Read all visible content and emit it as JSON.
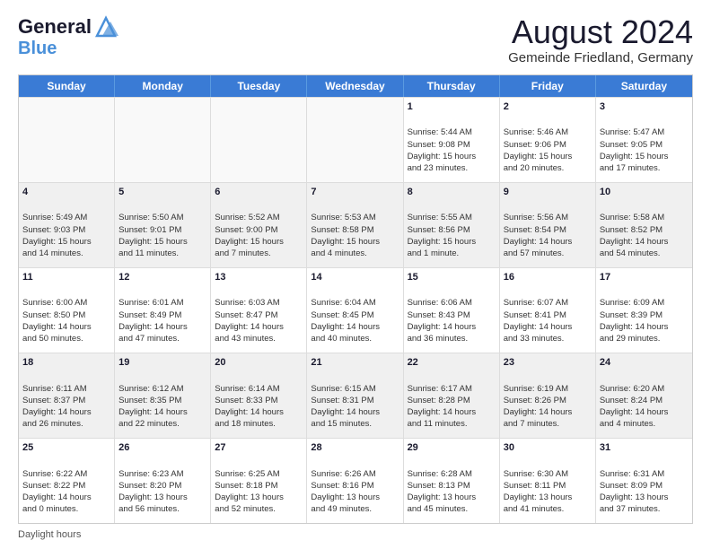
{
  "logo": {
    "line1": "General",
    "line2": "Blue"
  },
  "title": "August 2024",
  "subtitle": "Gemeinde Friedland, Germany",
  "days_of_week": [
    "Sunday",
    "Monday",
    "Tuesday",
    "Wednesday",
    "Thursday",
    "Friday",
    "Saturday"
  ],
  "footer_text": "Daylight hours",
  "weeks": [
    {
      "cells": [
        {
          "day": "",
          "empty": true
        },
        {
          "day": "",
          "empty": true
        },
        {
          "day": "",
          "empty": true
        },
        {
          "day": "",
          "empty": true
        },
        {
          "day": "1",
          "lines": [
            "Sunrise: 5:44 AM",
            "Sunset: 9:08 PM",
            "Daylight: 15 hours",
            "and 23 minutes."
          ]
        },
        {
          "day": "2",
          "lines": [
            "Sunrise: 5:46 AM",
            "Sunset: 9:06 PM",
            "Daylight: 15 hours",
            "and 20 minutes."
          ]
        },
        {
          "day": "3",
          "lines": [
            "Sunrise: 5:47 AM",
            "Sunset: 9:05 PM",
            "Daylight: 15 hours",
            "and 17 minutes."
          ]
        }
      ]
    },
    {
      "cells": [
        {
          "day": "4",
          "lines": [
            "Sunrise: 5:49 AM",
            "Sunset: 9:03 PM",
            "Daylight: 15 hours",
            "and 14 minutes."
          ]
        },
        {
          "day": "5",
          "lines": [
            "Sunrise: 5:50 AM",
            "Sunset: 9:01 PM",
            "Daylight: 15 hours",
            "and 11 minutes."
          ]
        },
        {
          "day": "6",
          "lines": [
            "Sunrise: 5:52 AM",
            "Sunset: 9:00 PM",
            "Daylight: 15 hours",
            "and 7 minutes."
          ]
        },
        {
          "day": "7",
          "lines": [
            "Sunrise: 5:53 AM",
            "Sunset: 8:58 PM",
            "Daylight: 15 hours",
            "and 4 minutes."
          ]
        },
        {
          "day": "8",
          "lines": [
            "Sunrise: 5:55 AM",
            "Sunset: 8:56 PM",
            "Daylight: 15 hours",
            "and 1 minute."
          ]
        },
        {
          "day": "9",
          "lines": [
            "Sunrise: 5:56 AM",
            "Sunset: 8:54 PM",
            "Daylight: 14 hours",
            "and 57 minutes."
          ]
        },
        {
          "day": "10",
          "lines": [
            "Sunrise: 5:58 AM",
            "Sunset: 8:52 PM",
            "Daylight: 14 hours",
            "and 54 minutes."
          ]
        }
      ]
    },
    {
      "cells": [
        {
          "day": "11",
          "lines": [
            "Sunrise: 6:00 AM",
            "Sunset: 8:50 PM",
            "Daylight: 14 hours",
            "and 50 minutes."
          ]
        },
        {
          "day": "12",
          "lines": [
            "Sunrise: 6:01 AM",
            "Sunset: 8:49 PM",
            "Daylight: 14 hours",
            "and 47 minutes."
          ]
        },
        {
          "day": "13",
          "lines": [
            "Sunrise: 6:03 AM",
            "Sunset: 8:47 PM",
            "Daylight: 14 hours",
            "and 43 minutes."
          ]
        },
        {
          "day": "14",
          "lines": [
            "Sunrise: 6:04 AM",
            "Sunset: 8:45 PM",
            "Daylight: 14 hours",
            "and 40 minutes."
          ]
        },
        {
          "day": "15",
          "lines": [
            "Sunrise: 6:06 AM",
            "Sunset: 8:43 PM",
            "Daylight: 14 hours",
            "and 36 minutes."
          ]
        },
        {
          "day": "16",
          "lines": [
            "Sunrise: 6:07 AM",
            "Sunset: 8:41 PM",
            "Daylight: 14 hours",
            "and 33 minutes."
          ]
        },
        {
          "day": "17",
          "lines": [
            "Sunrise: 6:09 AM",
            "Sunset: 8:39 PM",
            "Daylight: 14 hours",
            "and 29 minutes."
          ]
        }
      ]
    },
    {
      "cells": [
        {
          "day": "18",
          "lines": [
            "Sunrise: 6:11 AM",
            "Sunset: 8:37 PM",
            "Daylight: 14 hours",
            "and 26 minutes."
          ]
        },
        {
          "day": "19",
          "lines": [
            "Sunrise: 6:12 AM",
            "Sunset: 8:35 PM",
            "Daylight: 14 hours",
            "and 22 minutes."
          ]
        },
        {
          "day": "20",
          "lines": [
            "Sunrise: 6:14 AM",
            "Sunset: 8:33 PM",
            "Daylight: 14 hours",
            "and 18 minutes."
          ]
        },
        {
          "day": "21",
          "lines": [
            "Sunrise: 6:15 AM",
            "Sunset: 8:31 PM",
            "Daylight: 14 hours",
            "and 15 minutes."
          ]
        },
        {
          "day": "22",
          "lines": [
            "Sunrise: 6:17 AM",
            "Sunset: 8:28 PM",
            "Daylight: 14 hours",
            "and 11 minutes."
          ]
        },
        {
          "day": "23",
          "lines": [
            "Sunrise: 6:19 AM",
            "Sunset: 8:26 PM",
            "Daylight: 14 hours",
            "and 7 minutes."
          ]
        },
        {
          "day": "24",
          "lines": [
            "Sunrise: 6:20 AM",
            "Sunset: 8:24 PM",
            "Daylight: 14 hours",
            "and 4 minutes."
          ]
        }
      ]
    },
    {
      "cells": [
        {
          "day": "25",
          "lines": [
            "Sunrise: 6:22 AM",
            "Sunset: 8:22 PM",
            "Daylight: 14 hours",
            "and 0 minutes."
          ]
        },
        {
          "day": "26",
          "lines": [
            "Sunrise: 6:23 AM",
            "Sunset: 8:20 PM",
            "Daylight: 13 hours",
            "and 56 minutes."
          ]
        },
        {
          "day": "27",
          "lines": [
            "Sunrise: 6:25 AM",
            "Sunset: 8:18 PM",
            "Daylight: 13 hours",
            "and 52 minutes."
          ]
        },
        {
          "day": "28",
          "lines": [
            "Sunrise: 6:26 AM",
            "Sunset: 8:16 PM",
            "Daylight: 13 hours",
            "and 49 minutes."
          ]
        },
        {
          "day": "29",
          "lines": [
            "Sunrise: 6:28 AM",
            "Sunset: 8:13 PM",
            "Daylight: 13 hours",
            "and 45 minutes."
          ]
        },
        {
          "day": "30",
          "lines": [
            "Sunrise: 6:30 AM",
            "Sunset: 8:11 PM",
            "Daylight: 13 hours",
            "and 41 minutes."
          ]
        },
        {
          "day": "31",
          "lines": [
            "Sunrise: 6:31 AM",
            "Sunset: 8:09 PM",
            "Daylight: 13 hours",
            "and 37 minutes."
          ]
        }
      ]
    }
  ]
}
